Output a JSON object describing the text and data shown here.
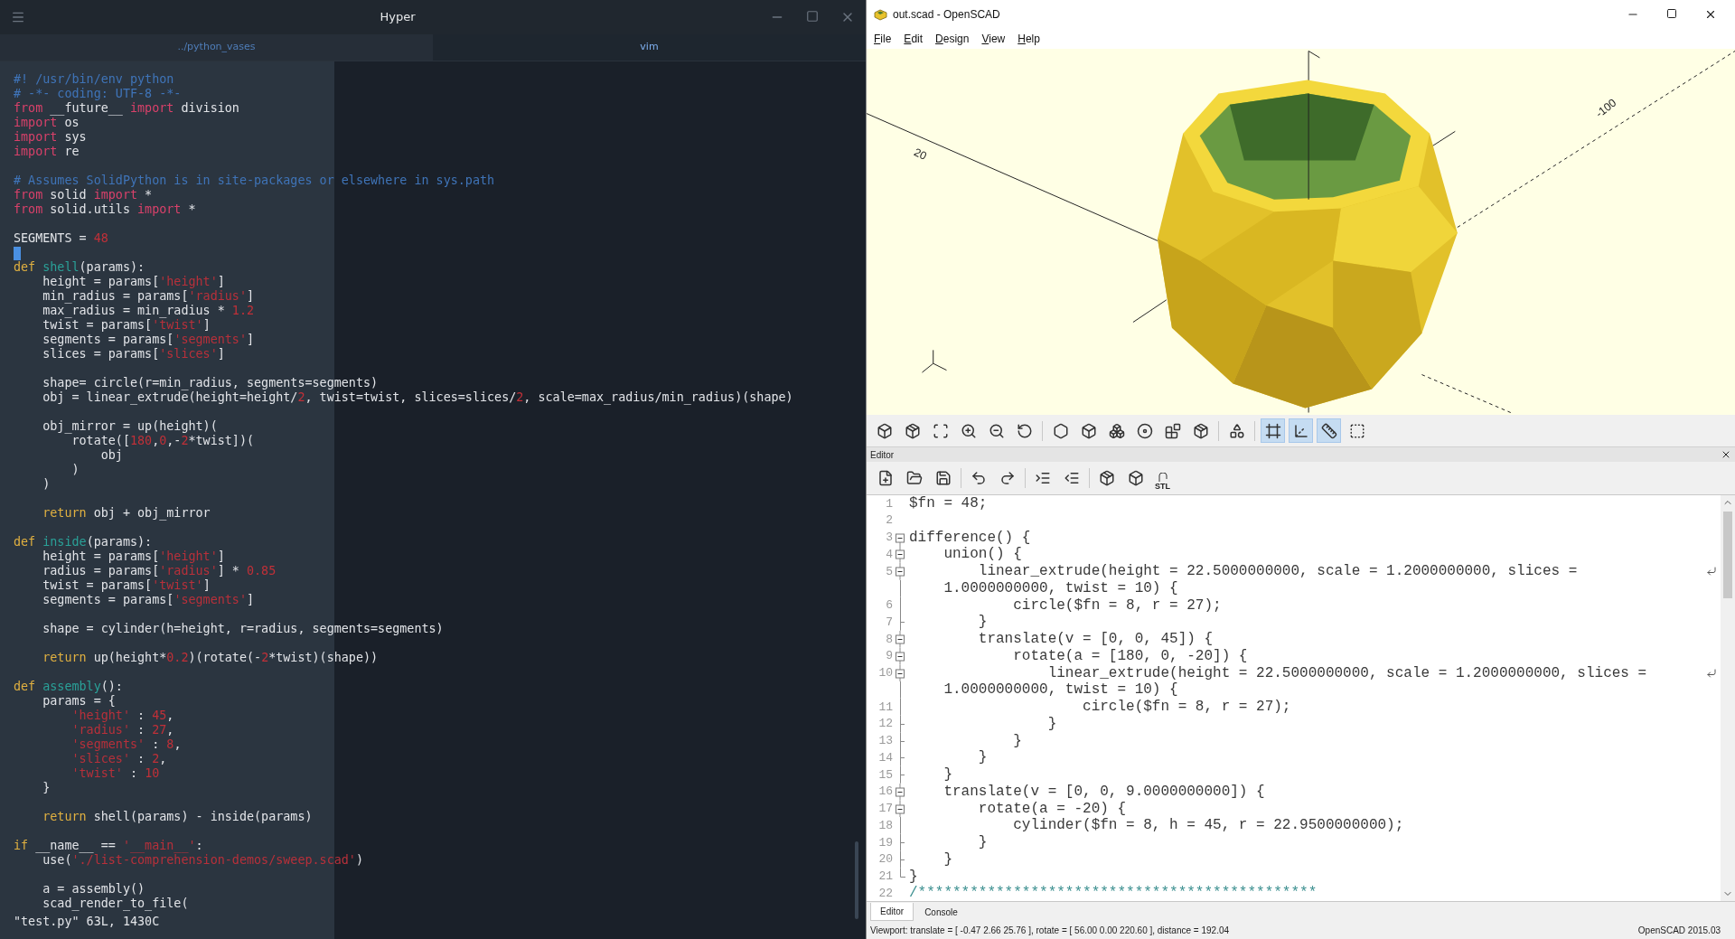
{
  "hyper": {
    "title": "Hyper",
    "tabs": [
      {
        "label": "../python_vases",
        "selected": false
      },
      {
        "label": "vim",
        "selected": true
      }
    ],
    "blocks": [
      [
        [
          {
            "kind": "comment",
            "text": "#! /usr/bin/env python"
          }
        ],
        [
          {
            "kind": "comment",
            "text": "# -*- coding: UTF-8 -*-"
          }
        ],
        [
          {
            "kind": "keyword",
            "text": "from"
          },
          {
            "kind": "plain",
            "text": " __future__ "
          },
          {
            "kind": "keyword",
            "text": "import"
          },
          {
            "kind": "plain",
            "text": " division"
          }
        ],
        [
          {
            "kind": "keyword",
            "text": "import"
          },
          {
            "kind": "plain",
            "text": " os"
          }
        ],
        [
          {
            "kind": "keyword",
            "text": "import"
          },
          {
            "kind": "plain",
            "text": " sys"
          }
        ],
        [
          {
            "kind": "keyword",
            "text": "import"
          },
          {
            "kind": "plain",
            "text": " re"
          }
        ]
      ],
      [
        [
          {
            "kind": "comment",
            "text": "# Assumes SolidPython is in site-packages or elsewhere in sys.path"
          }
        ],
        [
          {
            "kind": "keyword",
            "text": "from"
          },
          {
            "kind": "plain",
            "text": " solid "
          },
          {
            "kind": "keyword",
            "text": "import"
          },
          {
            "kind": "plain",
            "text": " *"
          }
        ],
        [
          {
            "kind": "keyword",
            "text": "from"
          },
          {
            "kind": "plain",
            "text": " solid.utils "
          },
          {
            "kind": "keyword",
            "text": "import"
          },
          {
            "kind": "plain",
            "text": " *"
          }
        ]
      ],
      [
        [
          {
            "kind": "plain",
            "text": "SEGMENTS = "
          },
          {
            "kind": "number",
            "text": "48"
          }
        ],
        {
          "cursor": true
        },
        [
          {
            "kind": "control",
            "text": "def "
          },
          {
            "kind": "function",
            "text": "shell"
          },
          {
            "kind": "plain",
            "text": "(params):"
          }
        ],
        [
          {
            "kind": "plain",
            "text": "    height = params["
          },
          {
            "kind": "string",
            "text": "'height'"
          },
          {
            "kind": "plain",
            "text": "]"
          }
        ],
        [
          {
            "kind": "plain",
            "text": "    min_radius = params["
          },
          {
            "kind": "string",
            "text": "'radius'"
          },
          {
            "kind": "plain",
            "text": "]"
          }
        ],
        [
          {
            "kind": "plain",
            "text": "    max_radius = min_radius * "
          },
          {
            "kind": "number",
            "text": "1.2"
          }
        ],
        [
          {
            "kind": "plain",
            "text": "    twist = params["
          },
          {
            "kind": "string",
            "text": "'twist'"
          },
          {
            "kind": "plain",
            "text": "]"
          }
        ],
        [
          {
            "kind": "plain",
            "text": "    segments = params["
          },
          {
            "kind": "string",
            "text": "'segments'"
          },
          {
            "kind": "plain",
            "text": "]"
          }
        ],
        [
          {
            "kind": "plain",
            "text": "    slices = params["
          },
          {
            "kind": "string",
            "text": "'slices'"
          },
          {
            "kind": "plain",
            "text": "]"
          }
        ]
      ],
      [
        [
          {
            "kind": "plain",
            "text": "    shape= circle(r=min_radius, segments=segments)"
          }
        ],
        [
          {
            "kind": "plain",
            "text": "    obj = linear_extrude(height=height/"
          },
          {
            "kind": "number",
            "text": "2"
          },
          {
            "kind": "plain",
            "text": ", twist=twist, slices=slices/"
          },
          {
            "kind": "number",
            "text": "2"
          },
          {
            "kind": "plain",
            "text": ", scale=max_radius/min_radius)(shape)"
          }
        ]
      ],
      [
        [
          {
            "kind": "plain",
            "text": "    obj_mirror = up(height)("
          }
        ],
        [
          {
            "kind": "plain",
            "text": "        rotate(["
          },
          {
            "kind": "number",
            "text": "180"
          },
          {
            "kind": "plain",
            "text": ","
          },
          {
            "kind": "number",
            "text": "0"
          },
          {
            "kind": "plain",
            "text": ",-"
          },
          {
            "kind": "number",
            "text": "2"
          },
          {
            "kind": "plain",
            "text": "*twist])("
          }
        ],
        [
          {
            "kind": "plain",
            "text": "            obj"
          }
        ],
        [
          {
            "kind": "plain",
            "text": "        )"
          }
        ],
        [
          {
            "kind": "plain",
            "text": "    )"
          }
        ]
      ],
      [
        [
          {
            "kind": "control",
            "text": "    return"
          },
          {
            "kind": "plain",
            "text": " obj + obj_mirror"
          }
        ]
      ],
      [
        [
          {
            "kind": "control",
            "text": "def "
          },
          {
            "kind": "function",
            "text": "inside"
          },
          {
            "kind": "plain",
            "text": "(params):"
          }
        ],
        [
          {
            "kind": "plain",
            "text": "    height = params["
          },
          {
            "kind": "string",
            "text": "'height'"
          },
          {
            "kind": "plain",
            "text": "]"
          }
        ],
        [
          {
            "kind": "plain",
            "text": "    radius = params["
          },
          {
            "kind": "string",
            "text": "'radius'"
          },
          {
            "kind": "plain",
            "text": "] * "
          },
          {
            "kind": "number",
            "text": "0.85"
          }
        ],
        [
          {
            "kind": "plain",
            "text": "    twist = params["
          },
          {
            "kind": "string",
            "text": "'twist'"
          },
          {
            "kind": "plain",
            "text": "]"
          }
        ],
        [
          {
            "kind": "plain",
            "text": "    segments = params["
          },
          {
            "kind": "string",
            "text": "'segments'"
          },
          {
            "kind": "plain",
            "text": "]"
          }
        ]
      ],
      [
        [
          {
            "kind": "plain",
            "text": "    shape = cylinder(h=height, r=radius, segments=segments)"
          }
        ]
      ],
      [
        [
          {
            "kind": "control",
            "text": "    return"
          },
          {
            "kind": "plain",
            "text": " up(height*"
          },
          {
            "kind": "number",
            "text": "0.2"
          },
          {
            "kind": "plain",
            "text": ")(rotate(-"
          },
          {
            "kind": "number",
            "text": "2"
          },
          {
            "kind": "plain",
            "text": "*twist)(shape))"
          }
        ]
      ],
      [
        [
          {
            "kind": "control",
            "text": "def "
          },
          {
            "kind": "function",
            "text": "assembly"
          },
          {
            "kind": "plain",
            "text": "():"
          }
        ],
        [
          {
            "kind": "plain",
            "text": "    params = {"
          }
        ],
        [
          {
            "kind": "string",
            "text": "        'height'"
          },
          {
            "kind": "plain",
            "text": " : "
          },
          {
            "kind": "number",
            "text": "45"
          },
          {
            "kind": "plain",
            "text": ","
          }
        ],
        [
          {
            "kind": "string",
            "text": "        'radius'"
          },
          {
            "kind": "plain",
            "text": " : "
          },
          {
            "kind": "number",
            "text": "27"
          },
          {
            "kind": "plain",
            "text": ","
          }
        ],
        [
          {
            "kind": "string",
            "text": "        'segments'"
          },
          {
            "kind": "plain",
            "text": " : "
          },
          {
            "kind": "number",
            "text": "8"
          },
          {
            "kind": "plain",
            "text": ","
          }
        ],
        [
          {
            "kind": "string",
            "text": "        'slices'"
          },
          {
            "kind": "plain",
            "text": " : "
          },
          {
            "kind": "number",
            "text": "2"
          },
          {
            "kind": "plain",
            "text": ","
          }
        ],
        [
          {
            "kind": "string",
            "text": "        'twist'"
          },
          {
            "kind": "plain",
            "text": " : "
          },
          {
            "kind": "number",
            "text": "10"
          }
        ],
        [
          {
            "kind": "plain",
            "text": "    }"
          }
        ]
      ],
      [
        [
          {
            "kind": "control",
            "text": "    return"
          },
          {
            "kind": "plain",
            "text": " shell(params) - inside(params)"
          }
        ]
      ],
      [
        [
          {
            "kind": "control",
            "text": "if"
          },
          {
            "kind": "plain",
            "text": " __name__ == "
          },
          {
            "kind": "string",
            "text": "'__main__'"
          },
          {
            "kind": "plain",
            "text": ":"
          }
        ],
        [
          {
            "kind": "plain",
            "text": "    use("
          },
          {
            "kind": "string",
            "text": "'./list-comprehension-demos/sweep.scad'"
          },
          {
            "kind": "plain",
            "text": ")"
          }
        ]
      ],
      [
        [
          {
            "kind": "plain",
            "text": "    a = assembly()"
          }
        ],
        [
          {
            "kind": "plain",
            "text": "    scad_render_to_file("
          }
        ]
      ]
    ],
    "status": "\"test.py\" 63L, 1430C"
  },
  "openscad": {
    "title": "out.scad - OpenSCAD",
    "menu": [
      "File",
      "Edit",
      "Design",
      "View",
      "Help"
    ],
    "axis_labels": [
      "20",
      "-100"
    ],
    "view_toolbar": [
      {
        "selected": false
      },
      {
        "selected": false
      },
      {
        "selected": false
      },
      {
        "selected": false
      },
      {
        "selected": false
      },
      {
        "selected": false
      },
      {
        "selected": false
      },
      {
        "selected": false
      },
      {
        "selected": false
      },
      {
        "selected": false
      },
      {
        "selected": false
      },
      {
        "selected": false
      },
      {
        "selected": false
      },
      {
        "selected": true
      },
      {
        "selected": true
      },
      {
        "selected": true
      },
      {
        "selected": false
      }
    ],
    "editor": {
      "title": "Editor",
      "export_label": "STL",
      "lines": [
        {
          "number": "1",
          "kind": "none",
          "text": "$fn = 48;"
        },
        {
          "number": "2",
          "kind": "none"
        },
        {
          "number": "3",
          "kind": "start",
          "text": "difference() {"
        },
        {
          "number": "4",
          "kind": "open",
          "text": "    union() {"
        },
        {
          "number": "5",
          "kind": "open",
          "text": "        linear_extrude(height = 22.5000000000, scale = 1.2000000000, slices =",
          "wrap": "    1.0000000000, twist = 10) {"
        },
        {
          "number": "6",
          "kind": "line",
          "text": "            circle($fn = 8, r = 27);"
        },
        {
          "number": "7",
          "kind": "tick",
          "text": "        }"
        },
        {
          "number": "8",
          "kind": "open",
          "text": "        translate(v = [0, 0, 45]) {"
        },
        {
          "number": "9",
          "kind": "open",
          "text": "            rotate(a = [180, 0, -20]) {"
        },
        {
          "number": "10",
          "kind": "open",
          "text": "                linear_extrude(height = 22.5000000000, scale = 1.2000000000, slices =",
          "wrap": "    1.0000000000, twist = 10) {"
        },
        {
          "number": "11",
          "kind": "line",
          "text": "                    circle($fn = 8, r = 27);"
        },
        {
          "number": "12",
          "kind": "tick",
          "text": "                }"
        },
        {
          "number": "13",
          "kind": "tick",
          "text": "            }"
        },
        {
          "number": "14",
          "kind": "tick",
          "text": "        }"
        },
        {
          "number": "15",
          "kind": "tick",
          "text": "    }"
        },
        {
          "number": "16",
          "kind": "open",
          "text": "    translate(v = [0, 0, 9.0000000000]) {"
        },
        {
          "number": "17",
          "kind": "open",
          "text": "        rotate(a = -20) {"
        },
        {
          "number": "18",
          "kind": "line",
          "text": "            cylinder($fn = 8, h = 45, r = 22.9500000000);"
        },
        {
          "number": "19",
          "kind": "tick",
          "text": "        }"
        },
        {
          "number": "20",
          "kind": "tick",
          "text": "    }"
        },
        {
          "number": "21",
          "kind": "end",
          "text": "}"
        },
        {
          "number": "22",
          "kind": "comment",
          "text": "/**********************************************"
        }
      ]
    },
    "tabs": [
      {
        "label": "Editor",
        "selected": true
      },
      {
        "label": "Console",
        "selected": false
      }
    ],
    "status": "Viewport: translate = [ -0.47 2.66 25.76 ], rotate = [ 56.00 0.00 220.60 ], distance = 192.04",
    "version": "OpenSCAD 2015.03"
  }
}
